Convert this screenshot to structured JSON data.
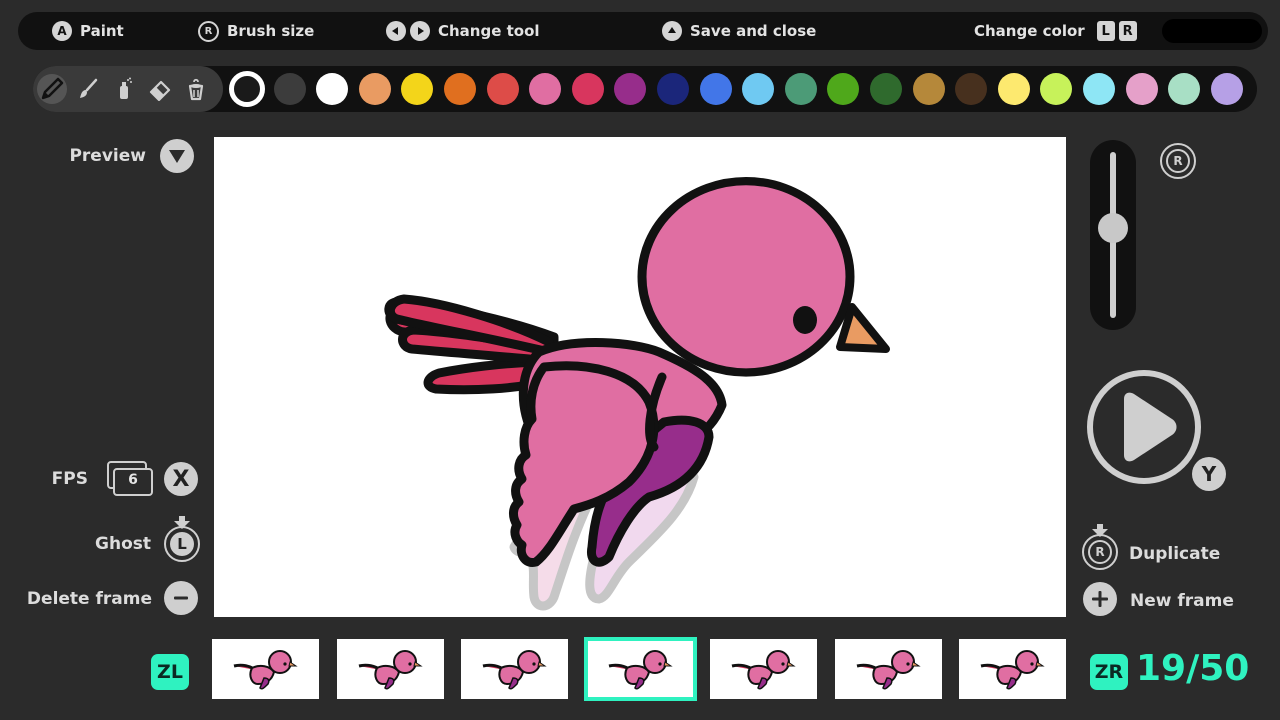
{
  "topbar": {
    "paint": {
      "button": "A",
      "label": "Paint"
    },
    "brush_size": {
      "button": "R",
      "label": "Brush size"
    },
    "change_tool": {
      "label": "Change tool"
    },
    "save_close": {
      "label": "Save and close"
    },
    "change_color": {
      "label": "Change color",
      "key_left": "L",
      "key_right": "R"
    }
  },
  "tools": [
    "pencil",
    "brush",
    "spray",
    "eraser",
    "bucket"
  ],
  "palette": [
    "#1a1a1a",
    "#3c3c3c",
    "#ffffff",
    "#e99b62",
    "#f3d51a",
    "#e06f1f",
    "#dd4c48",
    "#e06ea2",
    "#d8365e",
    "#972d8b",
    "#1b267a",
    "#4276e8",
    "#6fc9f2",
    "#4c9b77",
    "#4fa81b",
    "#2f6a2d",
    "#b5883a",
    "#47301e",
    "#fde96f",
    "#c7f25a",
    "#8ee6f5",
    "#e5a0c9",
    "#a8dfc5",
    "#b6a0e6"
  ],
  "selected_color_index": 0,
  "left_panel": {
    "preview": "Preview",
    "fps": "FPS",
    "fps_value": "6",
    "fps_button": "X",
    "ghost": "Ghost",
    "ghost_button": "L",
    "delete_frame": "Delete frame"
  },
  "right_panel": {
    "slider_button": "R",
    "play_button": "Y",
    "duplicate": "Duplicate",
    "duplicate_button": "R",
    "new_frame": "New frame"
  },
  "slider_level": 0.5,
  "frames": {
    "left_trigger": "ZL",
    "right_trigger": "ZR",
    "counter": "19/50",
    "visible_count": 7,
    "current_visible_index": 3
  },
  "colors": {
    "accent": "#2ff2c0",
    "bird_body": "#e06ea2",
    "bird_wing_dark": "#972d8b",
    "bird_tail": "#d8365e",
    "bird_beak": "#e99b62"
  }
}
